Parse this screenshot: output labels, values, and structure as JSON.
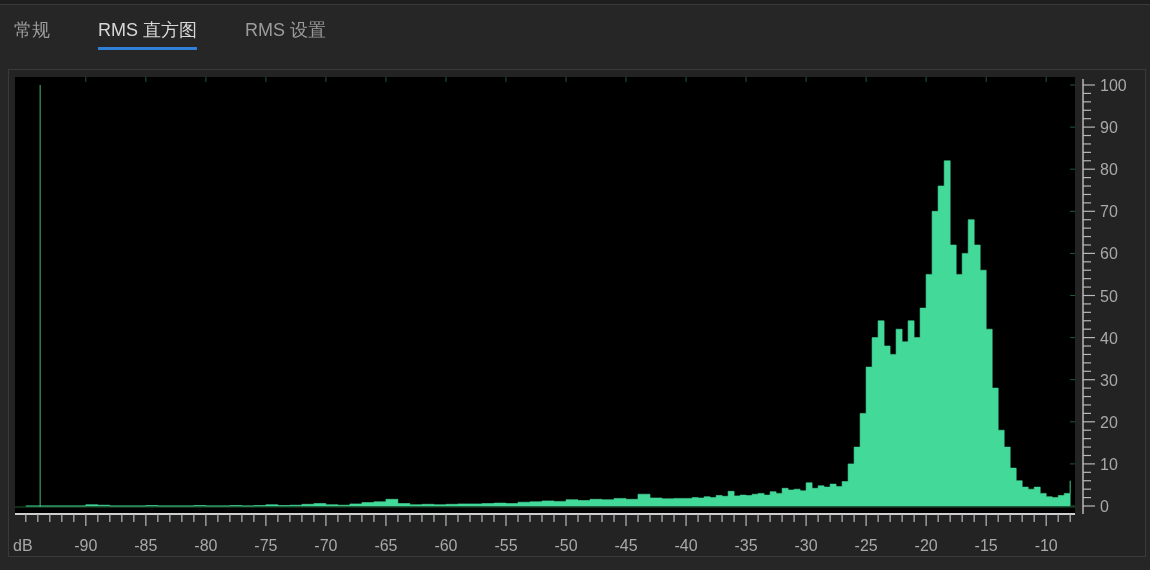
{
  "tabs": [
    {
      "label": "常规",
      "selected": false
    },
    {
      "label": "RMS 直方图",
      "selected": true
    },
    {
      "label": "RMS 设置",
      "selected": false
    }
  ],
  "histogram": {
    "chart_data": {
      "type": "area",
      "xlabel": "dB",
      "xlim": [
        -95.9,
        -7.6
      ],
      "ylim": [
        0,
        100
      ],
      "xticks": [
        -90,
        -85,
        -80,
        -75,
        -70,
        -65,
        -60,
        -55,
        -50,
        -45,
        -40,
        -35,
        -30,
        -25,
        -20,
        -15,
        -10
      ],
      "yticks": [
        0,
        10,
        20,
        30,
        40,
        50,
        60,
        70,
        80,
        90,
        100
      ],
      "ref_lines": [
        {
          "axis": "x",
          "value": -93.8
        }
      ],
      "x": [
        -95,
        -94,
        -93,
        -92,
        -91,
        -90,
        -89,
        -88,
        -87,
        -86,
        -85,
        -84,
        -83,
        -82,
        -81,
        -80,
        -79,
        -78,
        -77,
        -76,
        -75,
        -74,
        -73,
        -72,
        -71,
        -70,
        -69,
        -68,
        -67,
        -66,
        -65,
        -64,
        -63,
        -62,
        -61,
        -60,
        -59,
        -58,
        -57,
        -56,
        -55,
        -54,
        -53,
        -52,
        -51,
        -50,
        -49,
        -48,
        -47,
        -46,
        -45,
        -44,
        -43,
        -42,
        -41,
        -40,
        -39.5,
        -39,
        -38.5,
        -38,
        -37.5,
        -37,
        -36.5,
        -36,
        -35.5,
        -35,
        -34.5,
        -34,
        -33.5,
        -33,
        -32.5,
        -32,
        -31.5,
        -31,
        -30.5,
        -30,
        -29.5,
        -29,
        -28.5,
        -28,
        -27.5,
        -27,
        -26.5,
        -26,
        -25.5,
        -25,
        -24.5,
        -24,
        -23.5,
        -23,
        -22.5,
        -22,
        -21.5,
        -21,
        -20.5,
        -20,
        -19.5,
        -19,
        -18.5,
        -18,
        -17.5,
        -17,
        -16.5,
        -16,
        -15.5,
        -15,
        -14.5,
        -14,
        -13.5,
        -13,
        -12.5,
        -12,
        -11.5,
        -11,
        -10.5,
        -10,
        -9.5,
        -9,
        -8.5,
        -8
      ],
      "series": [
        {
          "color": "#43d998",
          "values": [
            0,
            0,
            0,
            0,
            0,
            0.3,
            0.2,
            0,
            0,
            0,
            0.1,
            0,
            0,
            0,
            0.1,
            0,
            0,
            0.1,
            0,
            0.1,
            0.3,
            0.1,
            0.2,
            0.4,
            0.6,
            0.3,
            0.2,
            0.5,
            0.8,
            1.0,
            1.6,
            0.6,
            0.3,
            0.4,
            0.3,
            0.4,
            0.5,
            0.5,
            0.6,
            0.7,
            0.6,
            0.9,
            1.0,
            1.2,
            1.1,
            1.5,
            1.3,
            1.6,
            1.5,
            1.8,
            1.6,
            2.8,
            1.9,
            1.7,
            1.8,
            1.8,
            2.0,
            1.9,
            2.2,
            2.0,
            2.5,
            2.3,
            3.5,
            2.4,
            2.6,
            2.5,
            2.8,
            3.0,
            2.6,
            3.4,
            3.0,
            4.2,
            3.8,
            4.0,
            3.6,
            5.5,
            4.2,
            4.8,
            4.5,
            5.2,
            4.6,
            5.8,
            10,
            14,
            22,
            33,
            40,
            44,
            38,
            36,
            42,
            39,
            44,
            40,
            47,
            55,
            70,
            76,
            82,
            62,
            55,
            60,
            68,
            62,
            56,
            42,
            28,
            18,
            14,
            9,
            6,
            4.5,
            4,
            4.5,
            3,
            2.2,
            2,
            2.5,
            3,
            6
          ]
        }
      ]
    }
  }
}
